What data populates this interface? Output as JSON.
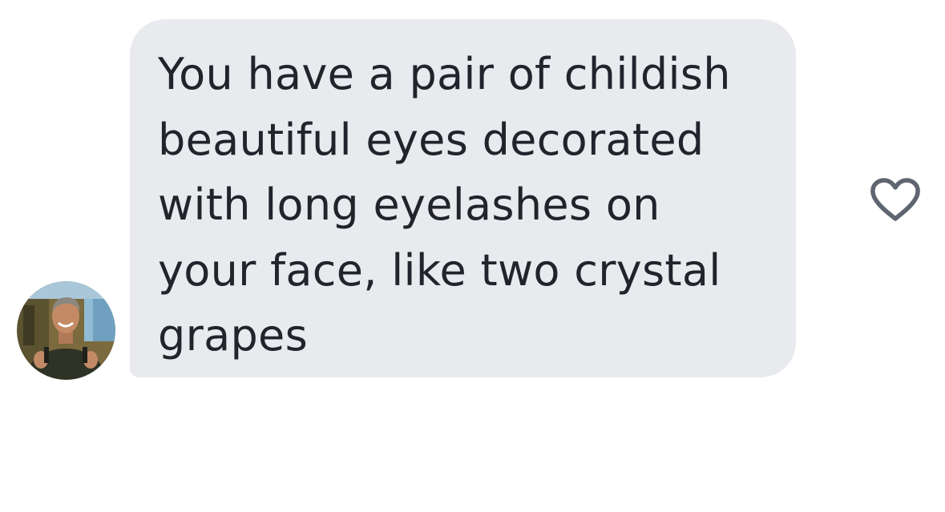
{
  "message": {
    "text": "You have a pair of childish\nbeautiful eyes decorated\nwith long eyelashes on\nyour face, like two crystal\ngrapes",
    "bubble_color": "#e9eaee",
    "text_color": "#22232b"
  },
  "sender": {
    "avatar_icon": "profile-photo"
  },
  "actions": {
    "like_icon": "heart-outline-icon",
    "like_color": "#5f6570"
  }
}
